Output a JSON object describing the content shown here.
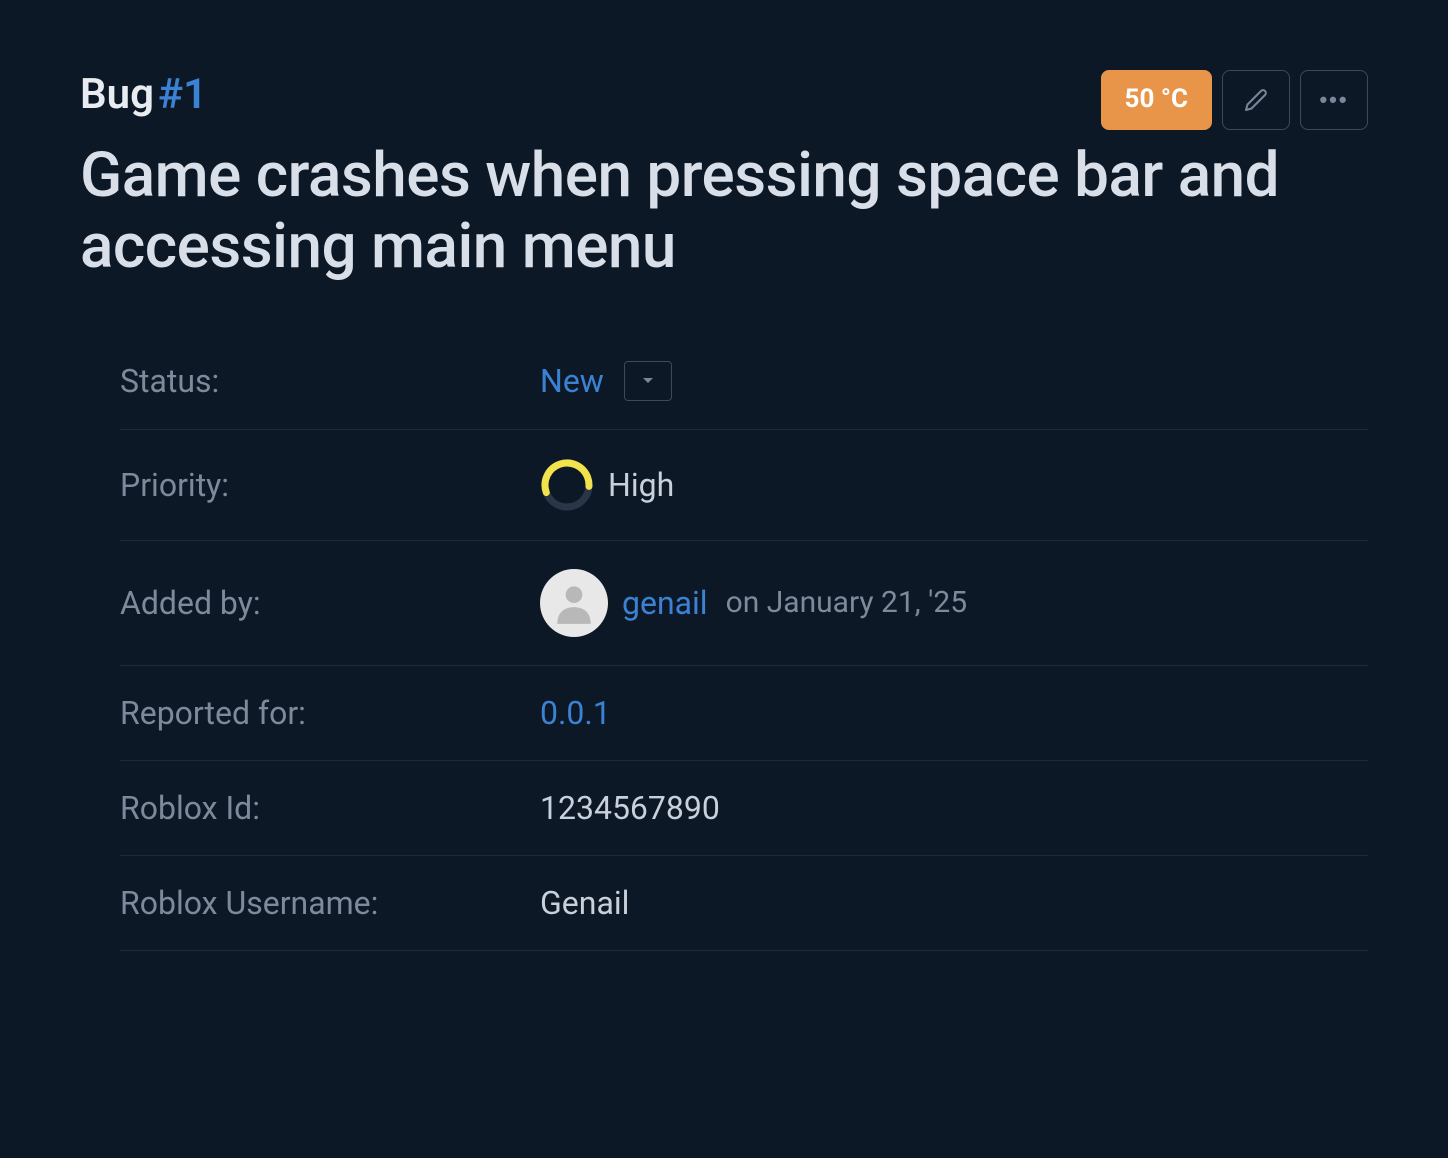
{
  "header": {
    "type_label": "Bug",
    "number_prefix": "#",
    "number": "1",
    "badge": "50 °C"
  },
  "title": "Game crashes when pressing space bar and accessing main menu",
  "fields": {
    "status": {
      "label": "Status:",
      "value": "New"
    },
    "priority": {
      "label": "Priority:",
      "value": "High"
    },
    "added_by": {
      "label": "Added by:",
      "user": "genail",
      "date": "on January 21, '25"
    },
    "reported_for": {
      "label": "Reported for:",
      "value": "0.0.1"
    },
    "roblox_id": {
      "label": "Roblox Id:",
      "value": "1234567890"
    },
    "roblox_username": {
      "label": "Roblox Username:",
      "value": "Genail"
    }
  }
}
